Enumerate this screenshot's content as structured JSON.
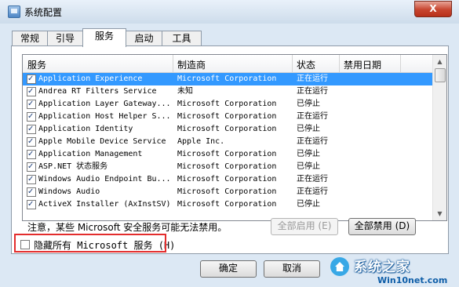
{
  "window": {
    "title": "系统配置",
    "close_label": "X"
  },
  "tabs": [
    "常规",
    "引导",
    "服务",
    "启动",
    "工具"
  ],
  "columns": {
    "service": "服务",
    "maker": "制造商",
    "status": "状态",
    "disabled_date": "禁用日期"
  },
  "rows": [
    {
      "name": "Application Experience",
      "maker": "Microsoft Corporation",
      "status": "正在运行",
      "checked": true,
      "selected": true
    },
    {
      "name": "Andrea RT Filters Service",
      "maker": "未知",
      "status": "正在运行",
      "checked": true
    },
    {
      "name": "Application Layer Gateway...",
      "maker": "Microsoft Corporation",
      "status": "已停止",
      "checked": true
    },
    {
      "name": "Application Host Helper S...",
      "maker": "Microsoft Corporation",
      "status": "正在运行",
      "checked": true
    },
    {
      "name": "Application Identity",
      "maker": "Microsoft Corporation",
      "status": "已停止",
      "checked": true
    },
    {
      "name": "Apple Mobile Device Service",
      "maker": "Apple Inc.",
      "status": "正在运行",
      "checked": true
    },
    {
      "name": "Application Management",
      "maker": "Microsoft Corporation",
      "status": "已停止",
      "checked": true
    },
    {
      "name": "ASP.NET 状态服务",
      "maker": "Microsoft Corporation",
      "status": "已停止",
      "checked": true
    },
    {
      "name": "Windows Audio Endpoint Bu...",
      "maker": "Microsoft Corporation",
      "status": "正在运行",
      "checked": true
    },
    {
      "name": "Windows Audio",
      "maker": "Microsoft Corporation",
      "status": "正在运行",
      "checked": true
    },
    {
      "name": "ActiveX Installer (AxInstSV)",
      "maker": "Microsoft Corporation",
      "status": "已停止",
      "checked": true
    }
  ],
  "note": "注意，某些 Microsoft 安全服务可能无法禁用。",
  "buttons": {
    "enable_all": "全部启用 (E)",
    "disable_all": "全部禁用 (D)",
    "ok": "确定",
    "cancel": "取消"
  },
  "hide_microsoft": {
    "label": "隐藏所有 Microsoft 服务 (H)",
    "checked": false
  },
  "watermark": {
    "name": "系统之家",
    "url": "Win10net.com"
  }
}
